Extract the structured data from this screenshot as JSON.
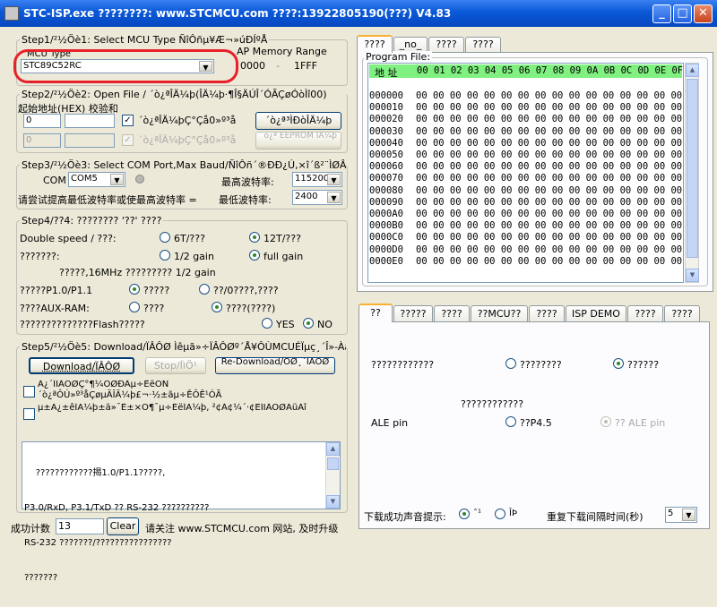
{
  "window": {
    "title": "STC-ISP.exe   ????????: www.STCMCU.com  ????:13922805190(???)  V4.83",
    "minimize": "_",
    "maximize": "□",
    "close": "✕"
  },
  "step1": {
    "title": "Step1/²½Öè1: Select MCU Type  ÑîÔñµ¥Æ¬»úÐÍºÅ",
    "mcu_type_label": "MCU Type",
    "mcu_type_value": "STC89C52RC",
    "ap_label": "AP Memory Range",
    "ap_start": "0000",
    "ap_dash": "-",
    "ap_end": "1FFF"
  },
  "step2": {
    "title": "Step2/²½Öè2: Open File /  ´ò¿ªÎÄ¼þ(ÎÄ¼þ·¶Î§ÄÚÎ´ÓÃÇøÓòÌî00)",
    "subtitle": "起始地址(HEX) 校验和",
    "addr1": "0",
    "addr2": "0",
    "chk1_label": "´ò¿ªÎÄ¼þÇ°Çå0»º³å",
    "chk2_label": "´ò¿ªÎÄ¼þÇ°Çå0»º³å",
    "open_prog_btn": "´ò¿ª³ÌÐòÎÄ¼þ",
    "open_eeprom_btn": "´ò¿ª EEPROM ÎÄ¼þ"
  },
  "step3": {
    "title": "Step3/²½Öè3: Select COM Port,Max Baud/ÑîÔñ´®ÐÐ¿Ú,×î´ß²¨ÌØÂÊ",
    "com_label": "COM",
    "com_value": "COM5",
    "max_baud_label": "最高波特率:",
    "max_baud_value": "115200",
    "hint": "请尝试提高最低波特率或使最高波特率 =",
    "min_baud_label": "最低波特率:",
    "min_baud_value": "2400"
  },
  "step4": {
    "title": "Step4/??4: ???????? '??' ????",
    "double_speed_label": "Double speed / ???:",
    "opt_6t": "6T/???",
    "opt_12t": "12T/???",
    "osc_label": "???????:",
    "opt_half_gain": "1/2 gain",
    "opt_full_gain": "full gain",
    "note_16mhz": "?????,16MHz ????????? 1/2 gain",
    "p10_label": "?????P1.0/P1.1",
    "p10_opt1": "?????",
    "p10_opt2": "??/0????,????",
    "aux_label": "????AUX-RAM:",
    "aux_opt1": "????",
    "aux_opt2": "????(????)",
    "flash_label": "??????????????Flash?????",
    "opt_yes": "YES",
    "opt_no": "NO"
  },
  "step5": {
    "title": "Step5/²½Öè5: Download/ÏÂÔØ  Ìêµã»÷ÏÂÔØº´Å¥ÔÙMCUÉÏµç¸´Î»-ÀäÆô¶¯",
    "download_btn": "Download/ÏÂÔØ",
    "stop_btn": "Stop/ÍìÖ¹",
    "redownload_btn": "Re-Download/ÖØ¸´ÏÂÔØ",
    "chk1_label": "Ã¿´ÎÏÂÔØÇ°¶¼ÖØÐÂµ÷ÈëÒÑ´ò¿ªÔÚ»º³åÇøµÄÎÄ¼þ£¬·½±ãµ÷ÊÔÊ¹ÓÃ",
    "chk2_label": "µ±Ä¿±êÎÄ¼þ±ä»¯Ê±×Ô¶¯µ÷ÈëÎÄ¼þ, ²¢Á¢¼´·¢ËÍÏÂÔØÃüÁî",
    "log_lines": [
      "    ????????????揭1.0/P1.1?????,",
      "P3.0/RxD, P3.1/TxD ?? RS-232 ??????????",
      "RS-232 ???????/????????????????",
      "???????"
    ]
  },
  "footer": {
    "success_label": "成功计数",
    "success_count": "13",
    "clear_btn": "Clear",
    "notice": "请关注 www.STCMCU.com 网站, 及时升级"
  },
  "right_top": {
    "tabs": [
      "????",
      "_no_",
      "????",
      "????"
    ],
    "program_file_label": "Program File:",
    "addr_header": "地 址",
    "col_header": "00 01 02 03 04 05 06 07 08 09 0A 0B 0C 0D 0E 0F",
    "rows": [
      {
        "addr": "000000",
        "data": "00 00 00 00 00 00 00 00 00 00 00 00 00 00 00 00"
      },
      {
        "addr": "000010",
        "data": "00 00 00 00 00 00 00 00 00 00 00 00 00 00 00 00"
      },
      {
        "addr": "000020",
        "data": "00 00 00 00 00 00 00 00 00 00 00 00 00 00 00 00"
      },
      {
        "addr": "000030",
        "data": "00 00 00 00 00 00 00 00 00 00 00 00 00 00 00 00"
      },
      {
        "addr": "000040",
        "data": "00 00 00 00 00 00 00 00 00 00 00 00 00 00 00 00"
      },
      {
        "addr": "000050",
        "data": "00 00 00 00 00 00 00 00 00 00 00 00 00 00 00 00"
      },
      {
        "addr": "000060",
        "data": "00 00 00 00 00 00 00 00 00 00 00 00 00 00 00 00"
      },
      {
        "addr": "000070",
        "data": "00 00 00 00 00 00 00 00 00 00 00 00 00 00 00 00"
      },
      {
        "addr": "000080",
        "data": "00 00 00 00 00 00 00 00 00 00 00 00 00 00 00 00"
      },
      {
        "addr": "000090",
        "data": "00 00 00 00 00 00 00 00 00 00 00 00 00 00 00 00"
      },
      {
        "addr": "0000A0",
        "data": "00 00 00 00 00 00 00 00 00 00 00 00 00 00 00 00"
      },
      {
        "addr": "0000B0",
        "data": "00 00 00 00 00 00 00 00 00 00 00 00 00 00 00 00"
      },
      {
        "addr": "0000C0",
        "data": "00 00 00 00 00 00 00 00 00 00 00 00 00 00 00 00"
      },
      {
        "addr": "0000D0",
        "data": "00 00 00 00 00 00 00 00 00 00 00 00 00 00 00 00"
      },
      {
        "addr": "0000E0",
        "data": "00 00 00 00 00 00 00 00 00 00 00 00 00 00 00 00"
      }
    ]
  },
  "right_bottom": {
    "tabs": [
      "??",
      "?????",
      "????",
      "??MCU??",
      "????",
      "ISP DEMO",
      "????",
      "????"
    ],
    "row1_label": "????????????",
    "row1_opt1": "????????",
    "row1_opt2": "??????",
    "row2_label": "????????????",
    "ale_label": "ALE pin",
    "ale_opt1": "??P4.5",
    "ale_opt2": "?? ALE pin",
    "sound_label": "下载成功声音提示:",
    "sound_opt1": "ˆ¹",
    "sound_opt2": "ÎÞ",
    "interval_label": "重复下载间隔时间(秒)",
    "interval_value": "5"
  },
  "colors": {
    "titlebar": "#0a58d8",
    "hex_header": "#80f080",
    "highlight_oval": "#e8202a"
  }
}
